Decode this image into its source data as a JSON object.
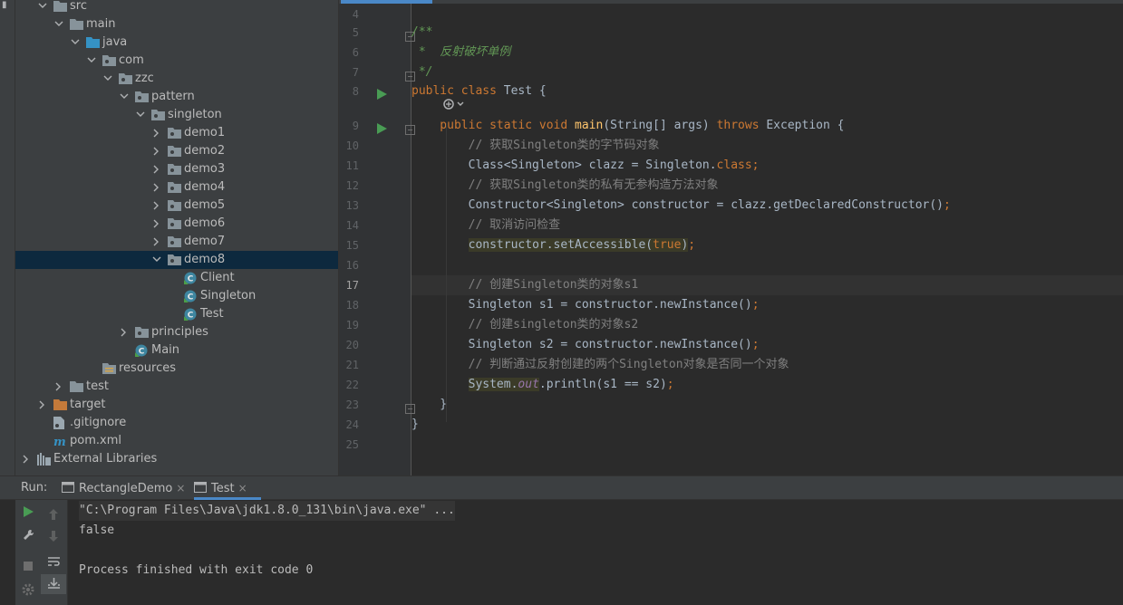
{
  "project_tree": {
    "items": [
      {
        "label": "src",
        "depth": 1,
        "expanded": true,
        "icon": "folder-icon"
      },
      {
        "label": "main",
        "depth": 2,
        "expanded": true,
        "icon": "folder-icon"
      },
      {
        "label": "java",
        "depth": 3,
        "expanded": true,
        "icon": "source-folder-icon"
      },
      {
        "label": "com",
        "depth": 4,
        "expanded": true,
        "icon": "package-icon"
      },
      {
        "label": "zzc",
        "depth": 5,
        "expanded": true,
        "icon": "package-icon"
      },
      {
        "label": "pattern",
        "depth": 6,
        "expanded": true,
        "icon": "package-icon"
      },
      {
        "label": "singleton",
        "depth": 7,
        "expanded": true,
        "icon": "package-icon"
      },
      {
        "label": "demo1",
        "depth": 8,
        "expanded": false,
        "icon": "package-icon"
      },
      {
        "label": "demo2",
        "depth": 8,
        "expanded": false,
        "icon": "package-icon"
      },
      {
        "label": "demo3",
        "depth": 8,
        "expanded": false,
        "icon": "package-icon"
      },
      {
        "label": "demo4",
        "depth": 8,
        "expanded": false,
        "icon": "package-icon"
      },
      {
        "label": "demo5",
        "depth": 8,
        "expanded": false,
        "icon": "package-icon"
      },
      {
        "label": "demo6",
        "depth": 8,
        "expanded": false,
        "icon": "package-icon"
      },
      {
        "label": "demo7",
        "depth": 8,
        "expanded": false,
        "icon": "package-icon"
      },
      {
        "label": "demo8",
        "depth": 8,
        "expanded": true,
        "icon": "package-icon",
        "selected": true
      },
      {
        "label": "Client",
        "depth": 9,
        "icon": "class-icon"
      },
      {
        "label": "Singleton",
        "depth": 9,
        "icon": "class-icon"
      },
      {
        "label": "Test",
        "depth": 9,
        "icon": "class-icon"
      },
      {
        "label": "principles",
        "depth": 6,
        "expanded": false,
        "icon": "package-icon"
      },
      {
        "label": "Main",
        "depth": 6,
        "icon": "class-icon"
      },
      {
        "label": "resources",
        "depth": 4,
        "icon": "resources-folder-icon"
      },
      {
        "label": "test",
        "depth": 2,
        "expanded": false,
        "icon": "folder-icon"
      },
      {
        "label": "target",
        "depth": 1,
        "expanded": false,
        "icon": "excluded-folder-icon"
      },
      {
        "label": ".gitignore",
        "depth": 1,
        "icon": "gitignore-icon"
      },
      {
        "label": "pom.xml",
        "depth": 1,
        "icon": "maven-icon"
      },
      {
        "label": "External Libraries",
        "depth": 0,
        "expanded": false,
        "icon": "libraries-icon"
      }
    ]
  },
  "editor": {
    "lines": [
      {
        "n": "4",
        "tokens": []
      },
      {
        "n": "5",
        "tokens": [
          {
            "t": "/**",
            "c": "doc"
          }
        ]
      },
      {
        "n": "6",
        "tokens": [
          {
            "t": " *  反射破坏单例",
            "c": "doc"
          }
        ]
      },
      {
        "n": "7",
        "tokens": [
          {
            "t": " */",
            "c": "doc"
          }
        ]
      },
      {
        "n": "8",
        "tokens": [
          {
            "t": "public class ",
            "c": "kw"
          },
          {
            "t": "Test {",
            "c": ""
          }
        ]
      },
      {
        "n": "",
        "tokens": []
      },
      {
        "n": "9",
        "tokens": [
          {
            "t": "    public static void ",
            "c": "kw"
          },
          {
            "t": "main",
            "c": "fn"
          },
          {
            "t": "(String[] args) ",
            "c": ""
          },
          {
            "t": "throws ",
            "c": "kw"
          },
          {
            "t": "Exception {",
            "c": ""
          }
        ]
      },
      {
        "n": "10",
        "tokens": [
          {
            "t": "        // 获取Singleton类的字节码对象",
            "c": "cm"
          }
        ]
      },
      {
        "n": "11",
        "tokens": [
          {
            "t": "        Class<Singleton> clazz = Singleton.",
            "c": ""
          },
          {
            "t": "class;",
            "c": "kw"
          }
        ]
      },
      {
        "n": "12",
        "tokens": [
          {
            "t": "        // 获取Singleton类的私有无参构造方法对象",
            "c": "cm"
          }
        ]
      },
      {
        "n": "13",
        "tokens": [
          {
            "t": "        Constructor<Singleton> constructor = clazz.getDeclaredConstructor()",
            "c": ""
          },
          {
            "t": ";",
            "c": "kw"
          }
        ]
      },
      {
        "n": "14",
        "tokens": [
          {
            "t": "        // 取消访问检查",
            "c": "cm"
          }
        ]
      },
      {
        "n": "15",
        "tokens": [
          {
            "t": "        ",
            "c": ""
          },
          {
            "t": "constructor.setAccessible(",
            "c": "hl"
          },
          {
            "t": "true",
            "c": "kw hl"
          },
          {
            "t": ")",
            "c": "hl"
          },
          {
            "t": ";",
            "c": "kw"
          }
        ]
      },
      {
        "n": "16",
        "tokens": []
      },
      {
        "n": "17",
        "tokens": [
          {
            "t": "        // 创建Singleton类的对象s1",
            "c": "cm"
          }
        ]
      },
      {
        "n": "18",
        "tokens": [
          {
            "t": "        Singleton s1 = constructor.newInstance()",
            "c": ""
          },
          {
            "t": ";",
            "c": "kw"
          }
        ]
      },
      {
        "n": "19",
        "tokens": [
          {
            "t": "        // 创建singleton类的对象s2",
            "c": "cm"
          }
        ]
      },
      {
        "n": "20",
        "tokens": [
          {
            "t": "        Singleton s2 = constructor.newInstance()",
            "c": ""
          },
          {
            "t": ";",
            "c": "kw"
          }
        ]
      },
      {
        "n": "21",
        "tokens": [
          {
            "t": "        // 判断通过反射创建的两个Singleton对象是否同一个对象",
            "c": "cm"
          }
        ]
      },
      {
        "n": "22",
        "tokens": [
          {
            "t": "        ",
            "c": ""
          },
          {
            "t": "System.",
            "c": "hl"
          },
          {
            "t": "out",
            "c": "st hl"
          },
          {
            "t": ".println(s1 == s2)",
            "c": ""
          },
          {
            "t": ";",
            "c": "kw"
          }
        ]
      },
      {
        "n": "23",
        "tokens": [
          {
            "t": "    }",
            "c": ""
          }
        ]
      },
      {
        "n": "24",
        "tokens": [
          {
            "t": "}",
            "c": ""
          }
        ]
      },
      {
        "n": "25",
        "tokens": []
      }
    ],
    "current_line": "17"
  },
  "run_panel": {
    "label": "Run:",
    "tabs": [
      {
        "label": "RectangleDemo",
        "active": false
      },
      {
        "label": "Test",
        "active": true
      }
    ],
    "close_glyph": "×",
    "console": [
      {
        "text": "\"C:\\Program Files\\Java\\jdk1.8.0_131\\bin\\java.exe\" ...",
        "cmd": true
      },
      {
        "text": "false",
        "cmd": false
      },
      {
        "text": "",
        "cmd": false
      },
      {
        "text": "Process finished with exit code 0",
        "cmd": false
      }
    ]
  },
  "colors": {
    "background": "#2b2b2b",
    "panel": "#3c3f41",
    "keyword": "#cc7832",
    "comment": "#808080",
    "doc_comment": "#629755",
    "method": "#ffc66d",
    "static_field": "#9876aa",
    "run_green": "#499c54",
    "selection": "#0d293e"
  }
}
